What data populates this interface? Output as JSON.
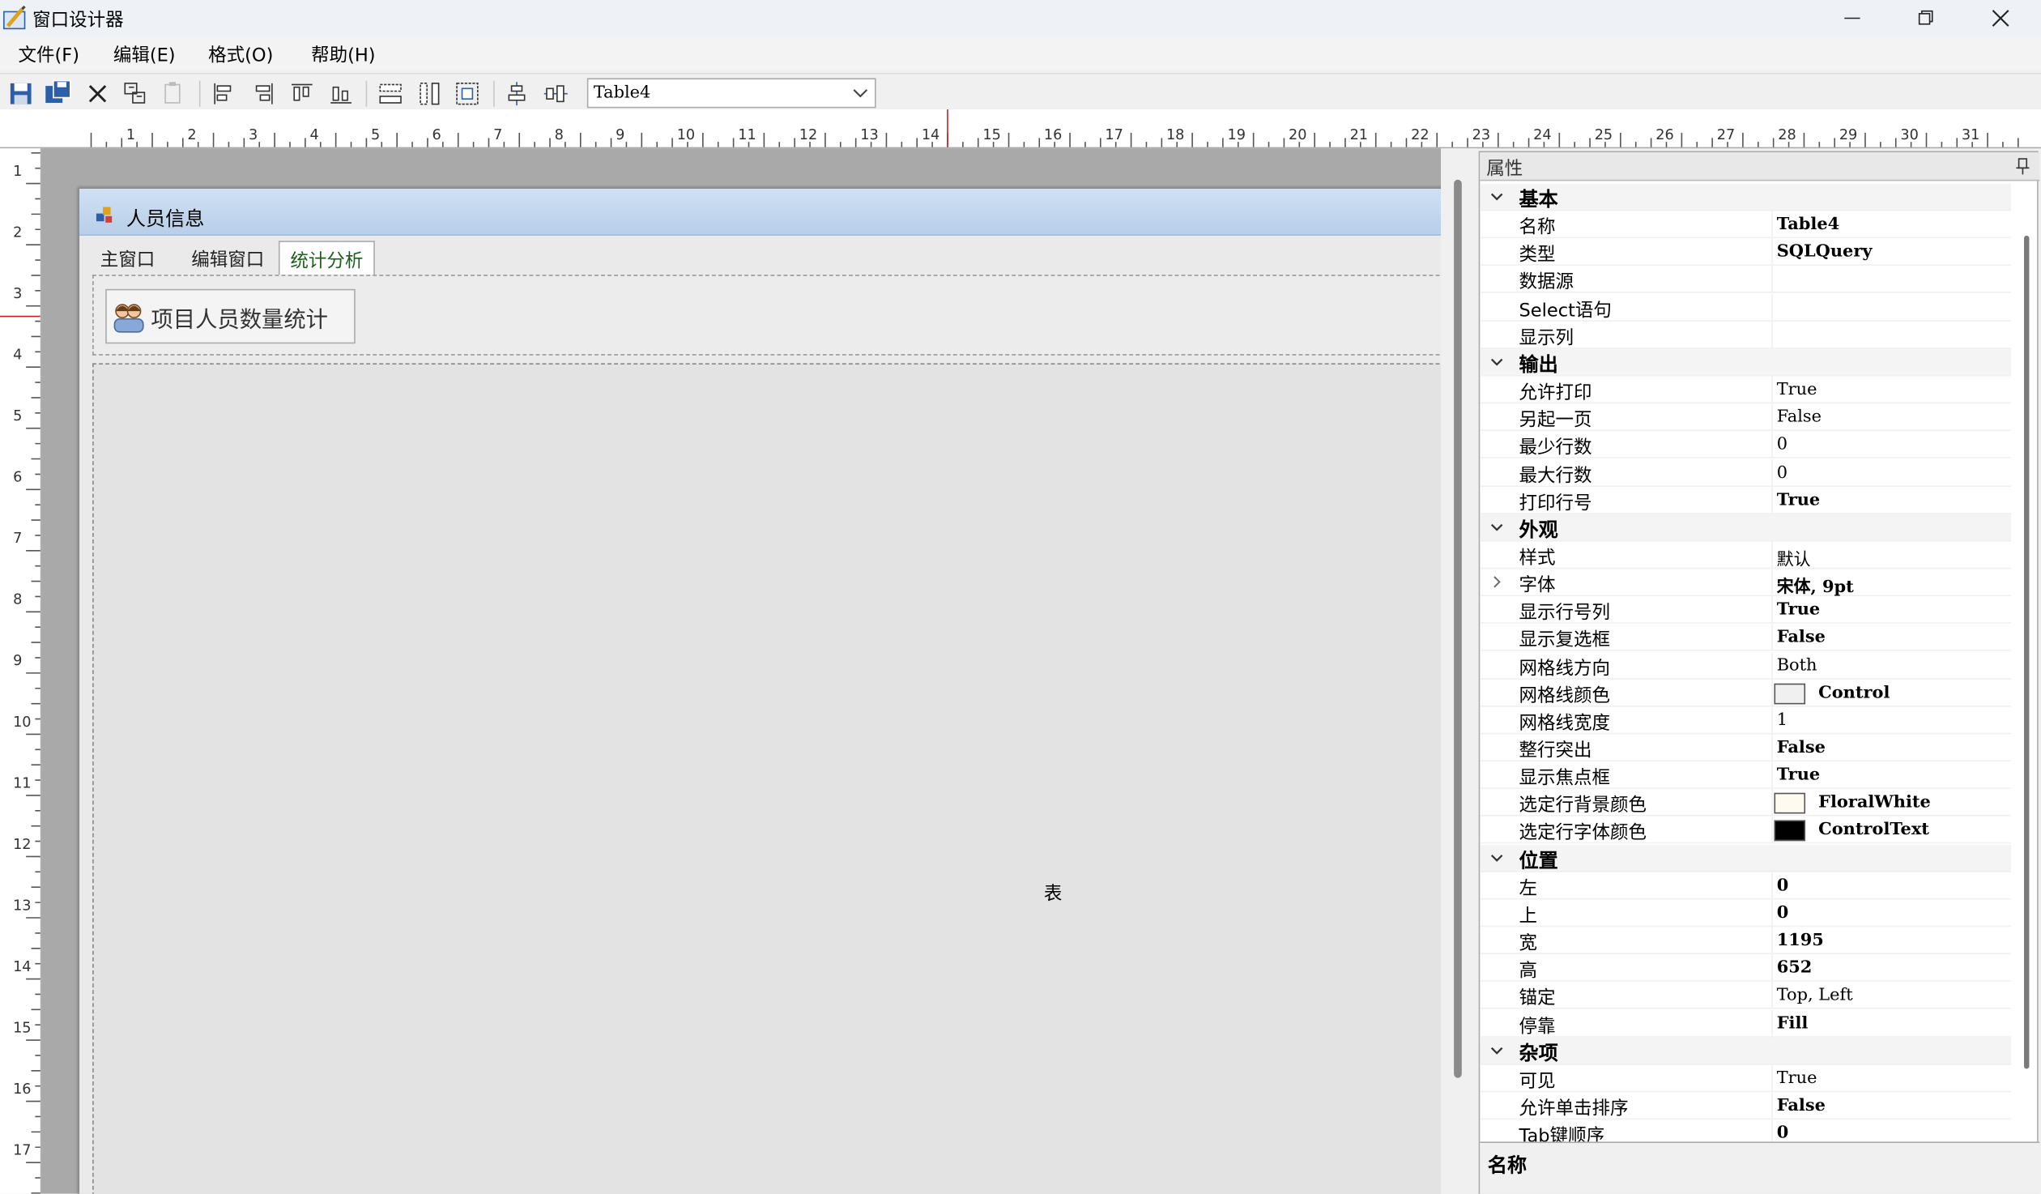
{
  "window": {
    "title": "窗口设计器"
  },
  "menu": [
    "文件(F)",
    "编辑(E)",
    "格式(O)",
    "帮助(H)"
  ],
  "toolbar": {
    "combo_value": "Table4"
  },
  "ruler": {
    "h_labels": [
      "1",
      "2",
      "3",
      "4",
      "5",
      "6",
      "7",
      "8",
      "9",
      "10",
      "11",
      "12",
      "13",
      "14",
      "15",
      "16",
      "17",
      "18",
      "19",
      "20",
      "21",
      "22",
      "23",
      "24",
      "25",
      "26",
      "27",
      "28",
      "29",
      "30",
      "31"
    ],
    "v_labels": [
      "1",
      "2",
      "3",
      "4",
      "5",
      "6",
      "7",
      "8",
      "9",
      "10",
      "11",
      "12",
      "13",
      "14",
      "15",
      "16",
      "17"
    ]
  },
  "form": {
    "title": "人员信息",
    "tabs": [
      "主窗口",
      "编辑窗口",
      "统计分析"
    ],
    "active_tab": 2,
    "stat_button": "项目人员数量统计",
    "table_label": "表"
  },
  "properties": {
    "title": "属性",
    "description_title": "名称",
    "rows": [
      {
        "cat": "基本"
      },
      {
        "name": "名称",
        "value": "Table4",
        "bold": true
      },
      {
        "name": "类型",
        "value": "SQLQuery",
        "bold": true
      },
      {
        "name": "数据源",
        "value": ""
      },
      {
        "name": "Select语句",
        "value": ""
      },
      {
        "name": "显示列",
        "value": ""
      },
      {
        "cat": "输出"
      },
      {
        "name": "允许打印",
        "value": "True"
      },
      {
        "name": "另起一页",
        "value": "False"
      },
      {
        "name": "最少行数",
        "value": "0"
      },
      {
        "name": "最大行数",
        "value": "0"
      },
      {
        "name": "打印行号",
        "value": "True",
        "bold": true
      },
      {
        "cat": "外观"
      },
      {
        "name": "样式",
        "value": "默认"
      },
      {
        "name": "字体",
        "value": "宋体, 9pt",
        "bold": true,
        "expand": true
      },
      {
        "name": "显示行号列",
        "value": "True",
        "bold": true
      },
      {
        "name": "显示复选框",
        "value": "False",
        "bold": true
      },
      {
        "name": "网格线方向",
        "value": "Both"
      },
      {
        "name": "网格线颜色",
        "value": "Control",
        "bold": true,
        "swatch": "#f0f0f0"
      },
      {
        "name": "网格线宽度",
        "value": "1"
      },
      {
        "name": "整行突出",
        "value": "False",
        "bold": true
      },
      {
        "name": "显示焦点框",
        "value": "True",
        "bold": true
      },
      {
        "name": "选定行背景颜色",
        "value": "FloralWhite",
        "bold": true,
        "swatch": "#fffaf0"
      },
      {
        "name": "选定行字体颜色",
        "value": "ControlText",
        "bold": true,
        "swatch": "#000000"
      },
      {
        "cat": "位置"
      },
      {
        "name": "左",
        "value": "0",
        "bold": true
      },
      {
        "name": "上",
        "value": "0",
        "bold": true
      },
      {
        "name": "宽",
        "value": "1195",
        "bold": true
      },
      {
        "name": "高",
        "value": "652",
        "bold": true
      },
      {
        "name": "锚定",
        "value": "Top, Left"
      },
      {
        "name": "停靠",
        "value": "Fill",
        "bold": true
      },
      {
        "cat": "杂项"
      },
      {
        "name": "可见",
        "value": "True"
      },
      {
        "name": "允许单击排序",
        "value": "False",
        "bold": true
      },
      {
        "name": "Tab键顺序",
        "value": "0",
        "bold": true
      }
    ]
  },
  "icons": [
    "app-icon",
    "minimize-icon",
    "maximize-icon",
    "close-icon",
    "save-icon",
    "save-all-icon",
    "delete-icon",
    "copy-icon",
    "paste-icon",
    "align-left-icon",
    "align-right-icon",
    "align-top-icon",
    "align-bottom-icon",
    "same-width-icon",
    "same-height-icon",
    "same-size-icon",
    "center-vertical-icon",
    "center-horizontal-icon",
    "chevron-down-icon",
    "form-icon",
    "people-icon",
    "pin-icon"
  ]
}
